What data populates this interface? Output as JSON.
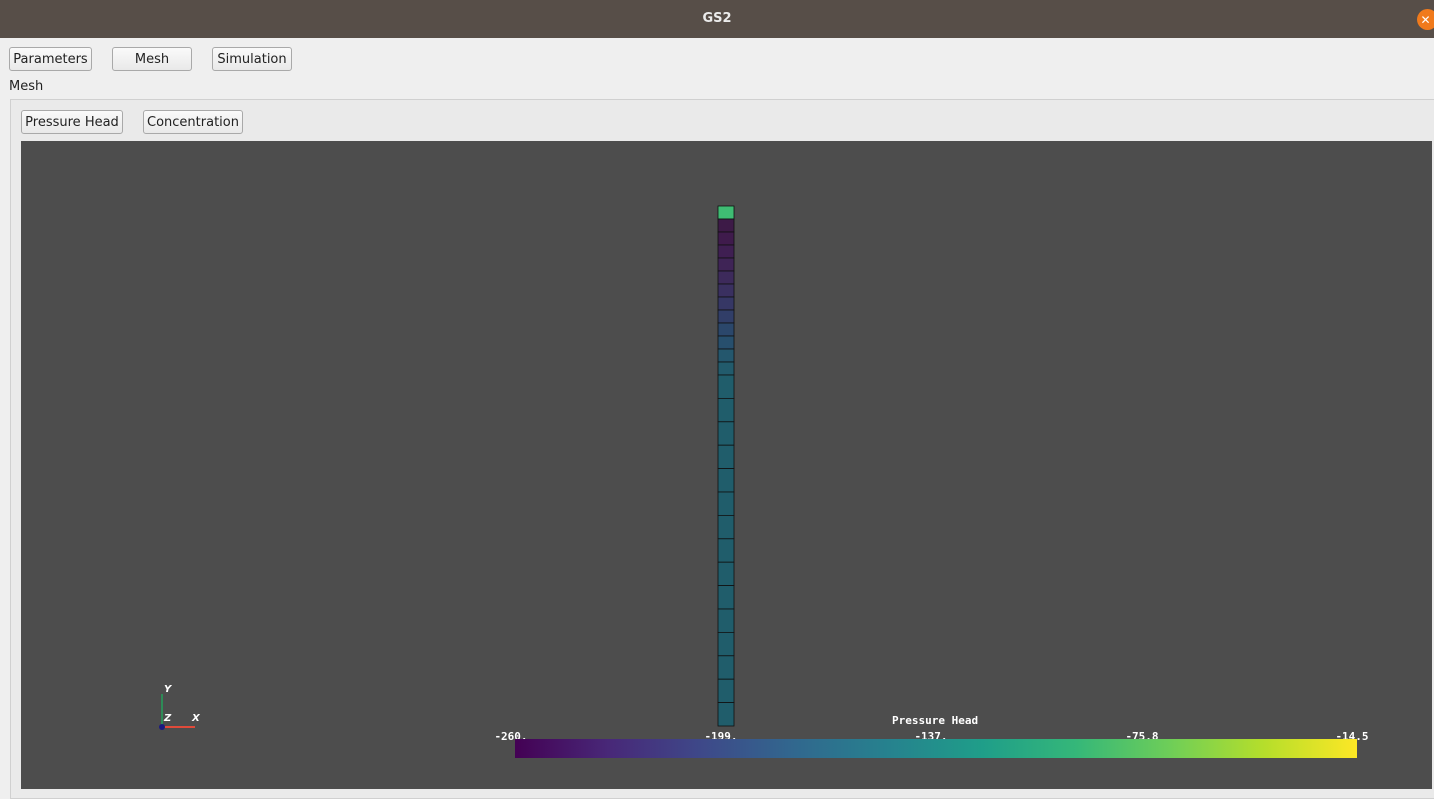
{
  "window": {
    "title": "GS2"
  },
  "toolbar": {
    "parameters": "Parameters",
    "mesh": "Mesh",
    "simulation": "Simulation"
  },
  "section": {
    "label": "Mesh"
  },
  "viewTabs": {
    "pressure_head": "Pressure Head",
    "concentration": "Concentration"
  },
  "colorbar": {
    "title": "Pressure Head",
    "ticks": [
      "-260.",
      "-199.",
      "-137.",
      "-75.8",
      "-14.5"
    ],
    "range": [
      -260,
      -14.5
    ]
  },
  "mesh_cells": [
    {
      "value": -75.8,
      "color": "#3fbc73"
    },
    {
      "value": -260,
      "color": "#3d1a47"
    },
    {
      "value": -258,
      "color": "#3f1b4c"
    },
    {
      "value": -254,
      "color": "#3f1f52"
    },
    {
      "value": -250,
      "color": "#3f2456"
    },
    {
      "value": -246,
      "color": "#3d2a5b"
    },
    {
      "value": -242,
      "color": "#3a3060"
    },
    {
      "value": -236,
      "color": "#363765"
    },
    {
      "value": -230,
      "color": "#313e68"
    },
    {
      "value": -222,
      "color": "#2b476b"
    },
    {
      "value": -214,
      "color": "#274f6d"
    },
    {
      "value": -205,
      "color": "#24576d"
    },
    {
      "value": -200,
      "color": "#225b6c"
    },
    {
      "value": -199,
      "color": "#205d6b"
    },
    {
      "value": -199,
      "color": "#205d6b"
    },
    {
      "value": -199,
      "color": "#205d6b"
    },
    {
      "value": -199,
      "color": "#205d6b"
    },
    {
      "value": -199,
      "color": "#205d6b"
    },
    {
      "value": -199,
      "color": "#205d6b"
    },
    {
      "value": -199,
      "color": "#205d6b"
    },
    {
      "value": -199,
      "color": "#205d6b"
    },
    {
      "value": -199,
      "color": "#205d6b"
    },
    {
      "value": -199,
      "color": "#205d6b"
    },
    {
      "value": -199,
      "color": "#205d6b"
    },
    {
      "value": -199,
      "color": "#205d6b"
    },
    {
      "value": -199,
      "color": "#205d6b"
    },
    {
      "value": -199,
      "color": "#205d6b"
    },
    {
      "value": -199,
      "color": "#205d6b"
    }
  ],
  "axes": {
    "x": "X",
    "y": "Y",
    "z": "Z"
  },
  "colors": {
    "background": "#4d4d4d",
    "titlebar": "#574e48",
    "close": "#f07a1c"
  }
}
